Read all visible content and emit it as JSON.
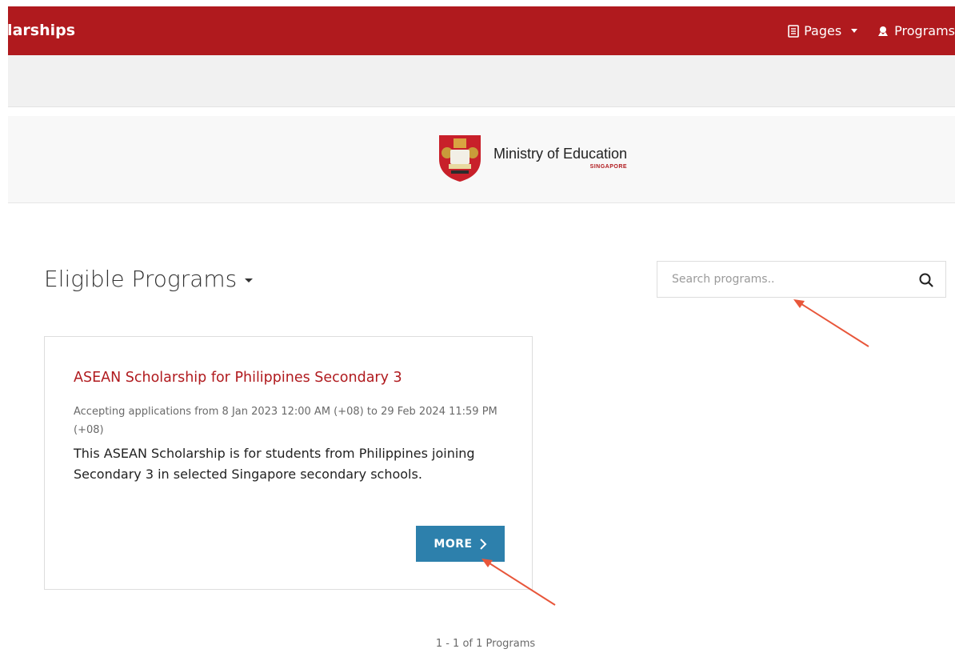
{
  "navbar": {
    "brand": "olarships",
    "items": [
      {
        "label": "Pages",
        "icon": "document-icon"
      },
      {
        "label": "Programs",
        "icon": "award-icon"
      }
    ],
    "color": "#b01a1e"
  },
  "banner": {
    "logo_title": "Ministry of Education",
    "logo_subtitle": "SINGAPORE"
  },
  "main": {
    "title": "Eligible Programs",
    "search": {
      "placeholder": "Search programs..",
      "value": ""
    },
    "programs": [
      {
        "title": "ASEAN Scholarship for Philippines Secondary 3",
        "dates": "Accepting applications from 8 Jan 2023 12:00 AM (+08) to 29 Feb 2024 11:59 PM (+08)",
        "description": "This ASEAN Scholarship is for students from Philippines joining Secondary 3 in selected Singapore secondary schools.",
        "button_label": "MORE"
      }
    ],
    "pagination": "1 - 1 of 1 Programs"
  },
  "colors": {
    "brand_red": "#b01a1e",
    "button_blue": "#2d80ac",
    "annotation_arrow": "#e8563a"
  }
}
